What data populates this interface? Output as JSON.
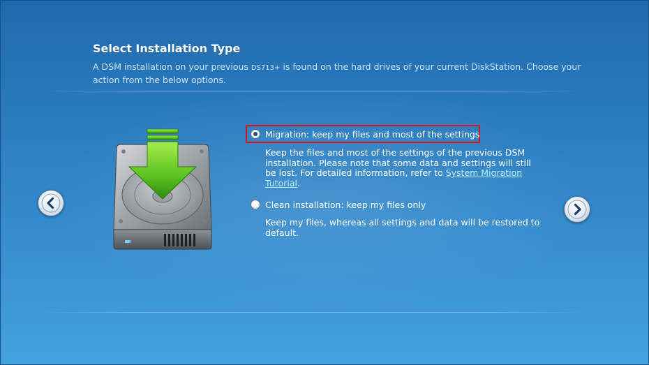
{
  "header": {
    "title": "Select Installation Type",
    "description_prefix": "A DSM installation on your previous",
    "model": "DS713+",
    "description_suffix": "is found on the hard drives of your current DiskStation. Choose your action from the below options."
  },
  "options": {
    "migration": {
      "label": "Migration: keep my files and most of the settings",
      "selected": true,
      "description": "Keep the files and most of the settings of the previous DSM installation. Please note that some data and settings will still be lost. For detailed information, refer to",
      "link_text": "System Migration Tutorial",
      "description_end": "."
    },
    "clean": {
      "label": "Clean installation: keep my files only",
      "selected": false,
      "description": "Keep my files, whereas all settings and data will be restored to default."
    }
  },
  "navigation": {
    "prev_icon": "chevron-left-icon",
    "next_icon": "chevron-right-icon"
  },
  "illustration": {
    "icon": "hard-drive-download-icon"
  },
  "colors": {
    "background_top": "#1f6aae",
    "background_bottom": "#43a3e0",
    "highlight_border": "#d0161e",
    "arrow_green": "#5cc21f",
    "link": "#bff0ff"
  }
}
